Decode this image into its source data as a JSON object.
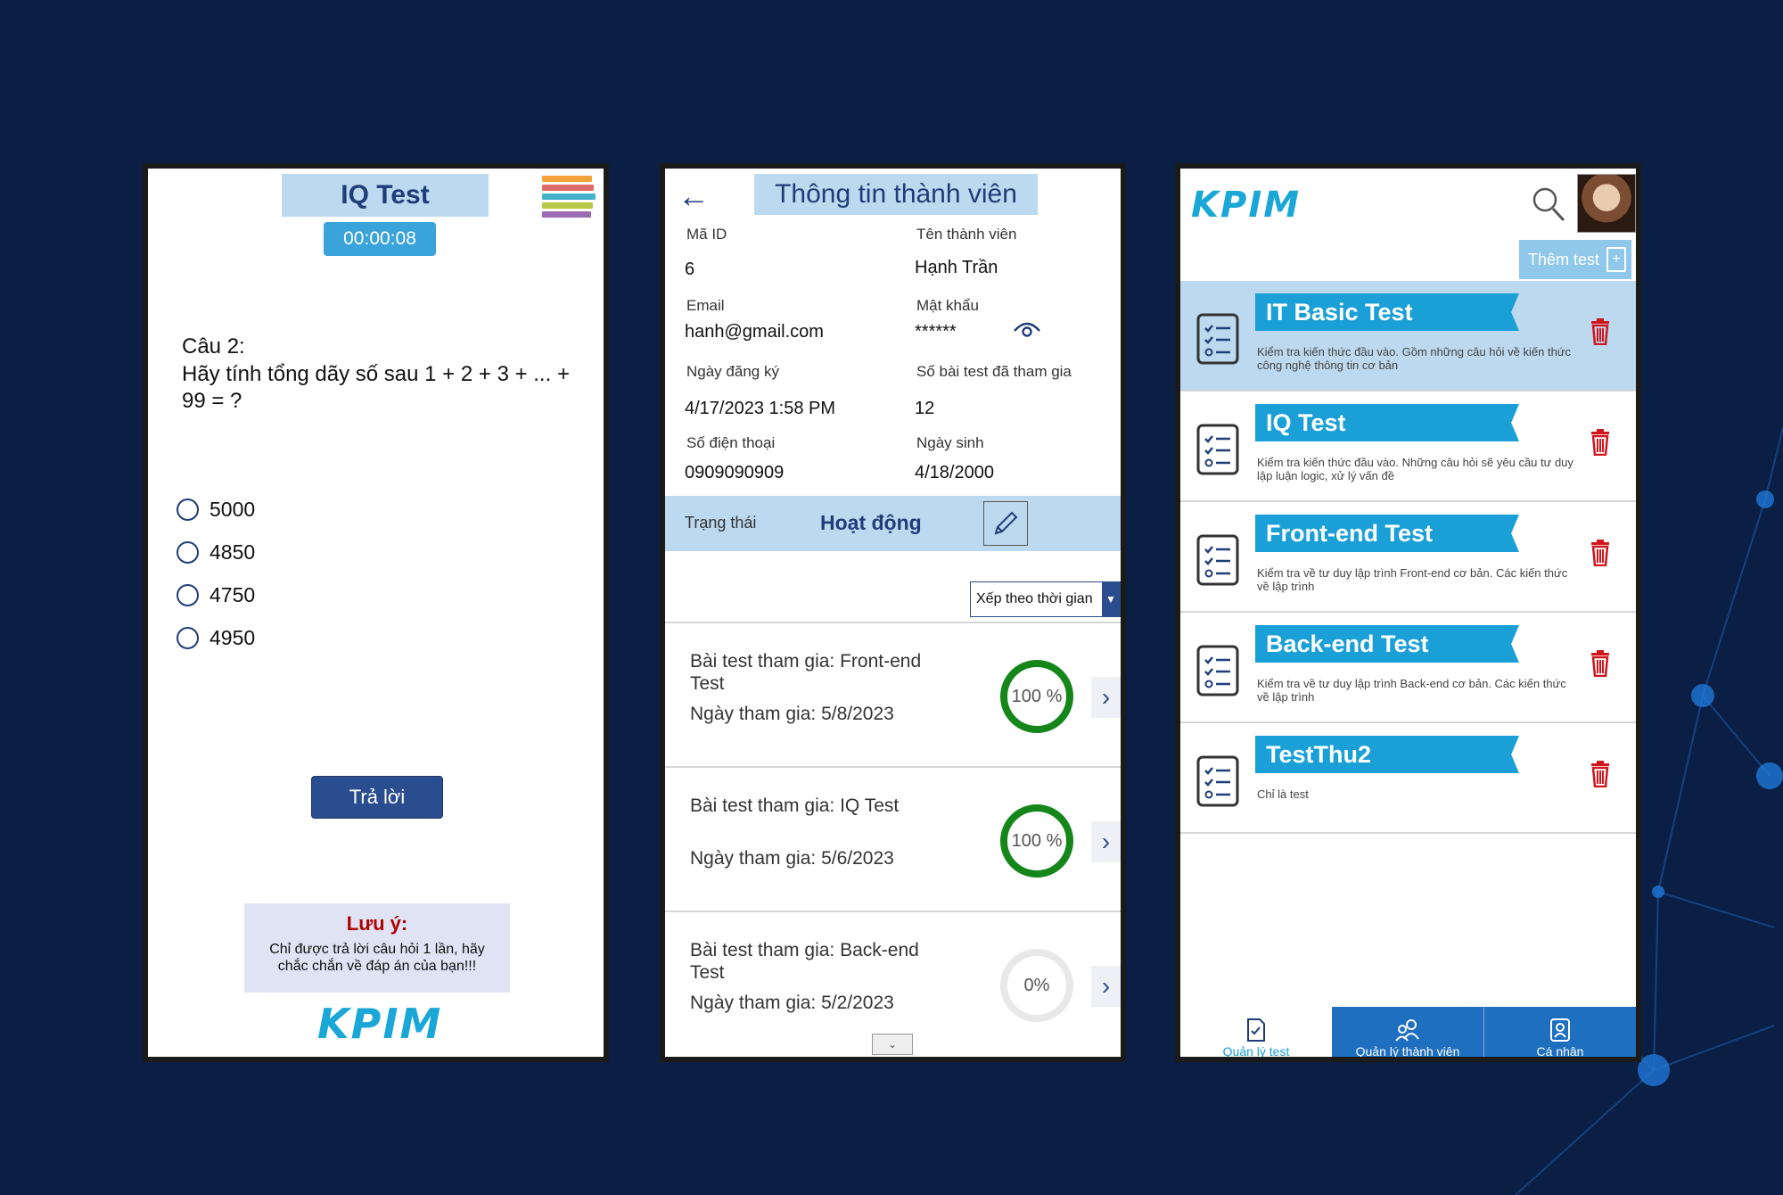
{
  "colors": {
    "background": "#0b1f44",
    "accent": "#1aa0d6",
    "title_bar": "#bcd9ef",
    "primary": "#2a4d8f",
    "delete": "#d0161c",
    "ring_full": "#14861a"
  },
  "quiz": {
    "title": "IQ Test",
    "timer": "00:00:08",
    "question_label": "Câu 2:",
    "question_text": "Hãy tính tổng dãy số sau 1 + 2 + 3 + ... + 99 = ?",
    "options": [
      "5000",
      "4850",
      "4750",
      "4950"
    ],
    "submit_label": "Trả lời",
    "note_title": "Lưu ý:",
    "note_text": "Chỉ được trả lời câu hỏi 1 lần, hãy chắc chắn về đáp án của bạn!!!",
    "logo": "KPIM"
  },
  "member": {
    "title": "Thông tin thành viên",
    "fields": {
      "id_label": "Mã ID",
      "id_value": "6",
      "name_label": "Tên thành viên",
      "name_value": "Hạnh Trần",
      "email_label": "Email",
      "email_value": "hanh@gmail.com",
      "password_label": "Mật khẩu",
      "password_value": "******",
      "reg_label": "Ngày đăng ký",
      "reg_value": "4/17/2023 1:58 PM",
      "count_label": "Số bài test đã tham gia",
      "count_value": "12",
      "phone_label": "Số điện thoại",
      "phone_value": "0909090909",
      "dob_label": "Ngày sinh",
      "dob_value": "4/18/2000"
    },
    "status_label": "Trạng thái",
    "status_value": "Hoạt động",
    "sort_label": "Xếp theo thời gian",
    "records": [
      {
        "name": "Bài test tham gia: Front-end Test",
        "date": "Ngày tham gia: 5/8/2023",
        "score_text": "100 %",
        "score": 100
      },
      {
        "name": "Bài test tham gia: IQ Test",
        "date": "Ngày tham gia: 5/6/2023",
        "score_text": "100 %",
        "score": 100
      },
      {
        "name": "Bài test tham gia: Back-end Test",
        "date": "Ngày tham gia: 5/2/2023",
        "score_text": "0%",
        "score": 0
      }
    ]
  },
  "tests": {
    "logo": "KPIM",
    "add_label": "Thêm test",
    "items": [
      {
        "title": "IT Basic Test",
        "desc": "Kiểm tra kiến thức đầu vào. Gồm những câu hỏi về kiến thức công nghệ thông tin cơ bản"
      },
      {
        "title": "IQ Test",
        "desc": "Kiểm tra kiến thức đầu vào. Những câu hỏi sẽ yêu cầu tư duy lập luận logic, xử lý vấn đề"
      },
      {
        "title": "Front-end Test",
        "desc": "Kiểm tra về tư duy lập trình Front-end cơ bản. Các kiến thức về lập trình"
      },
      {
        "title": "Back-end Test",
        "desc": "Kiểm tra về tư duy lập trình Back-end cơ bản. Các kiến thức về lập trình"
      },
      {
        "title": "TestThu2",
        "desc": "Chỉ là test"
      }
    ],
    "nav": [
      "Quản lý test",
      "Quản lý thành viên",
      "Cá nhân"
    ]
  }
}
